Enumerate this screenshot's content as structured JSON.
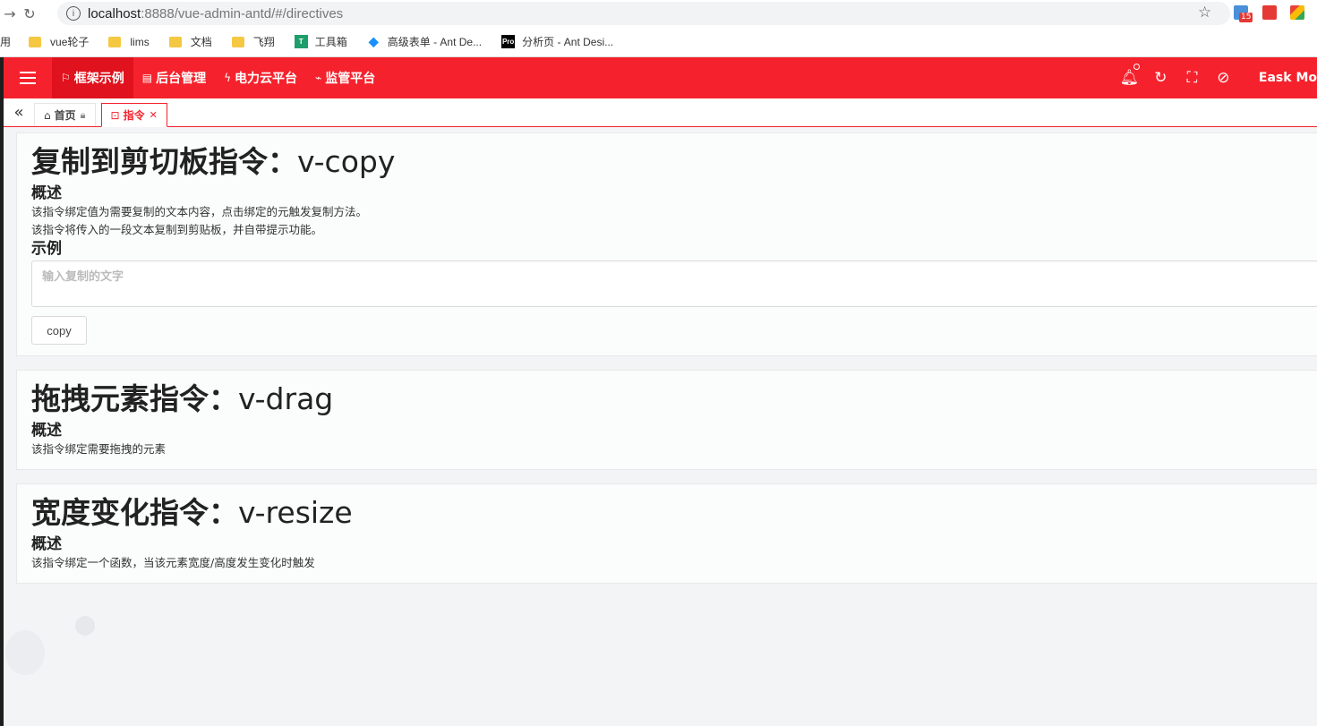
{
  "browser": {
    "url_host": "localhost",
    "url_path": ":8888/vue-admin-antd/#/directives",
    "bookmarks": [
      {
        "label": "用",
        "icon": "none"
      },
      {
        "label": "vue轮子",
        "icon": "folder-icon"
      },
      {
        "label": "lims",
        "icon": "folder-icon"
      },
      {
        "label": "文档",
        "icon": "folder-icon"
      },
      {
        "label": "飞翔",
        "icon": "folder-icon"
      },
      {
        "label": "工具箱",
        "icon": "teal-square-icon"
      },
      {
        "label": "高级表单 - Ant De...",
        "icon": "ant-design-icon"
      },
      {
        "label": "分析页 - Ant Desi...",
        "icon": "pro-icon"
      }
    ],
    "ext_badge": "15"
  },
  "header": {
    "menu": [
      {
        "label": "框架示例",
        "icon": "flag-icon",
        "active": true
      },
      {
        "label": "后台管理",
        "icon": "book-icon",
        "active": false
      },
      {
        "label": "电力云平台",
        "icon": "thunder-icon",
        "active": false
      },
      {
        "label": "监管平台",
        "icon": "line-chart-icon",
        "active": false
      }
    ],
    "user_name": "Eask Mo"
  },
  "tabs": [
    {
      "label": "首页",
      "icon": "home-icon",
      "trail": "lock-icon",
      "active": false
    },
    {
      "label": "指令",
      "icon": "code-icon",
      "trail": "close-icon",
      "active": true
    }
  ],
  "cards": {
    "copy": {
      "title_cn": "复制到剪切板指令：",
      "title_code": "v-copy",
      "overview_label": "概述",
      "desc1": "该指令绑定值为需要复制的文本内容，点击绑定的元触发复制方法。",
      "desc2": "该指令将传入的一段文本复制到剪贴板，并自带提示功能。",
      "example_label": "示例",
      "input_placeholder": "输入复制的文字",
      "button_label": "copy"
    },
    "drag": {
      "title_cn": "拖拽元素指令：",
      "title_code": "v-drag",
      "overview_label": "概述",
      "desc1": "该指令绑定需要拖拽的元素"
    },
    "resize": {
      "title_cn": "宽度变化指令：",
      "title_code": "v-resize",
      "overview_label": "概述",
      "desc1": "该指令绑定一个函数，当该元素宽度/高度发生变化时触发"
    }
  },
  "colors": {
    "primary": "#f5222d",
    "active_menu": "#e0121d"
  }
}
